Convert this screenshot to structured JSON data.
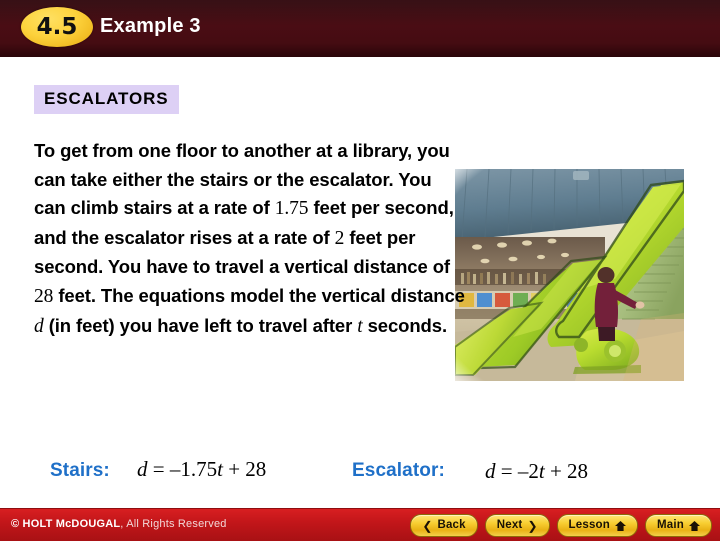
{
  "header": {
    "lesson_number": "4.5",
    "title": "Example 3",
    "background_color": "#450c12",
    "badge_color": "#f8cf3c"
  },
  "slide": {
    "topic_label": "ESCALATORS",
    "topic_label_bg": "#ddd0f5",
    "problem_text_parts": [
      {
        "text": "To get from one floor to another at a library, you can take either the stairs or the escalator. You can climb stairs at a rate of ",
        "style": "bold"
      },
      {
        "text": "1.75",
        "style": "number"
      },
      {
        "text": " feet per second, and the escalator rises at a rate of ",
        "style": "bold"
      },
      {
        "text": "2",
        "style": "number"
      },
      {
        "text": " feet per second. You have to travel a vertical distance of ",
        "style": "bold"
      },
      {
        "text": "28",
        "style": "number"
      },
      {
        "text": " feet. The equations model the vertical distance ",
        "style": "bold"
      },
      {
        "text": "d",
        "style": "variable"
      },
      {
        "text": " (in feet) you have left to travel after ",
        "style": "bold"
      },
      {
        "text": "t",
        "style": "variable"
      },
      {
        "text": " seconds.",
        "style": "bold"
      }
    ],
    "photo_alt": "escalator-photo"
  },
  "equations": {
    "label_color": "#1f70c8",
    "stairs": {
      "label": "Stairs:",
      "variable": "d",
      "equals": " = ",
      "coefficient": "–1.75",
      "time_variable": "t",
      "plus": " + ",
      "constant": "28",
      "full": "d = –1.75t + 28"
    },
    "escalator": {
      "label": "Escalator:",
      "variable": "d",
      "equals": " = ",
      "coefficient": "–2",
      "time_variable": "t",
      "plus": " + ",
      "constant": "28",
      "full": "d = –2t + 28"
    }
  },
  "footer": {
    "background_color": "#c3161a",
    "copyright_strong": "© HOLT McDOUGAL",
    "copyright_rest": ", All Rights Reserved",
    "buttons": [
      {
        "label": "Back",
        "icon": "chevron-left-icon",
        "glyph": "❮",
        "icon_side": "left"
      },
      {
        "label": "Next",
        "icon": "chevron-right-icon",
        "glyph": "❯",
        "icon_side": "right"
      },
      {
        "label": "Lesson",
        "icon": "home-icon",
        "glyph": "⌂",
        "icon_side": "right"
      },
      {
        "label": "Main",
        "icon": "home-icon",
        "glyph": "⌂",
        "icon_side": "right"
      }
    ]
  }
}
